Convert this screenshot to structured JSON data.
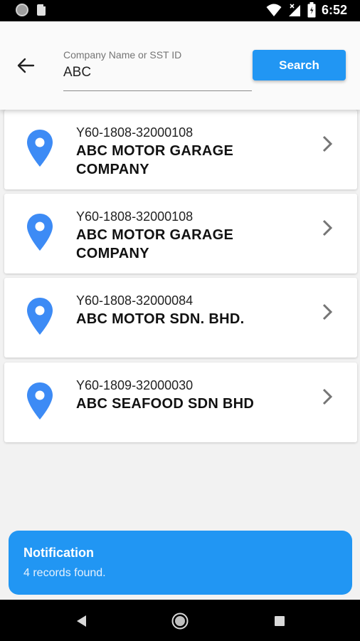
{
  "status_bar": {
    "time": "6:52",
    "icons": [
      "circle-icon",
      "sd-card-icon",
      "wifi-icon",
      "signal-icon",
      "battery-icon"
    ]
  },
  "search": {
    "label": "Company Name or SST ID",
    "value": "ABC",
    "button_label": "Search"
  },
  "results": [
    {
      "id": "Y60-1808-32000108",
      "name": "ABC MOTOR GARAGE COMPANY"
    },
    {
      "id": "Y60-1808-32000108",
      "name": "ABC MOTOR GARAGE COMPANY"
    },
    {
      "id": "Y60-1808-32000084",
      "name": "ABC MOTOR SDN. BHD."
    },
    {
      "id": "Y60-1809-32000030",
      "name": "ABC SEAFOOD SDN BHD"
    }
  ],
  "notification": {
    "title": "Notification",
    "message": "4 records found."
  },
  "colors": {
    "accent": "#2196f3",
    "pin": "#3d8bf5"
  }
}
